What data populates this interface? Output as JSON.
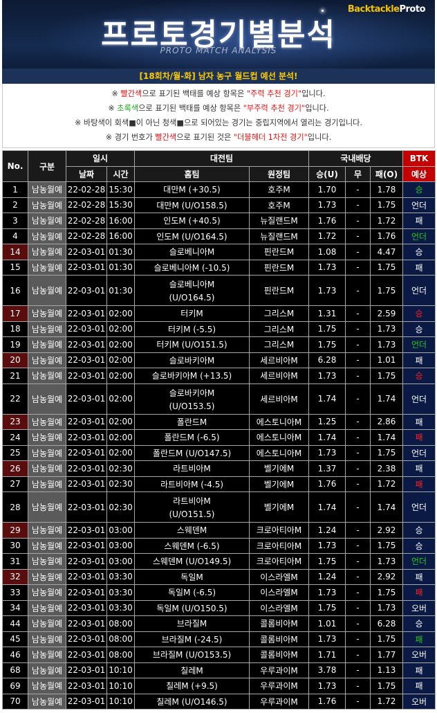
{
  "banner": {
    "brand_main": "Backtackle",
    "brand_sub": "Proto",
    "title": "프로토경기별분석",
    "subtitle": "PROTO MATCH ANALYSIS"
  },
  "round_title": "[18회차/월-화] 남자 농구 월드컵 예선 분석!",
  "notes": {
    "n1": {
      "pre": "※ ",
      "c1": "빨간색",
      "mid": "으로 표기된 백태를 예상 항목은 ",
      "c2": "\"주력 추천 경기\"",
      "post": "입니다."
    },
    "n2": {
      "pre": "※ ",
      "c1": "초록색",
      "mid": "으로 표기된 백태를 예상 항목은 ",
      "c2": "\"부주력 추천 경기\"",
      "post": "입니다."
    },
    "n3": "※ 바탕색이 회색■이 아닌 청색■으로 되어있는 경기는 중립지역에서 열리는 경기입니다.",
    "n4": {
      "pre": "※ 경기 번호가 ",
      "c1": "빨간색",
      "mid": "으로 표기된 것은 ",
      "c2": "\"더블헤더 1차전 경기\"",
      "post": "입니다."
    }
  },
  "table": {
    "headers": {
      "no": "No.",
      "gubun": "구분",
      "ilsi": "일시",
      "date": "날짜",
      "time": "시간",
      "match": "대전팀",
      "home": "홈팀",
      "away": "원정팀",
      "odds": "국내배당",
      "win": "승(U)",
      "draw": "무",
      "lose": "패(O)",
      "btk": "BTK",
      "pred": "예상"
    },
    "colors": {
      "main_pick": "#ff2222",
      "sub_pick": "#1ec81e",
      "normal": "#ffffff",
      "doubleheader_no": "#5a0d0d"
    },
    "rows": [
      {
        "no": "1",
        "gubun": "남농월예",
        "date": "22-02-28",
        "time": "15:30",
        "home": "대만M (+30.5)",
        "away": "호주M",
        "w": "1.70",
        "d": "-",
        "l": "1.78",
        "pred": "승",
        "pc": "green",
        "dh": false,
        "tall": false
      },
      {
        "no": "2",
        "gubun": "남농월예",
        "date": "22-02-28",
        "time": "15:30",
        "home": "대만M (U/O158.5)",
        "away": "호주M",
        "w": "1.73",
        "d": "-",
        "l": "1.75",
        "pred": "언더",
        "pc": "white",
        "dh": false,
        "tall": false
      },
      {
        "no": "3",
        "gubun": "남농월예",
        "date": "22-02-28",
        "time": "16:00",
        "home": "인도M (+40.5)",
        "away": "뉴질랜드M",
        "w": "1.76",
        "d": "-",
        "l": "1.72",
        "pred": "패",
        "pc": "white",
        "dh": false,
        "tall": false
      },
      {
        "no": "4",
        "gubun": "남농월예",
        "date": "22-02-28",
        "time": "16:00",
        "home": "인도M (U/O164.5)",
        "away": "뉴질랜드M",
        "w": "1.72",
        "d": "-",
        "l": "1.76",
        "pred": "언더",
        "pc": "green",
        "dh": false,
        "tall": false
      },
      {
        "no": "14",
        "gubun": "남농월예",
        "date": "22-03-01",
        "time": "01:30",
        "home": "슬로베니아M",
        "away": "핀란드M",
        "w": "1.08",
        "d": "-",
        "l": "4.47",
        "pred": "승",
        "pc": "white",
        "dh": true,
        "tall": false
      },
      {
        "no": "15",
        "gubun": "남농월예",
        "date": "22-03-01",
        "time": "01:30",
        "home": "슬로베니아M (-10.5)",
        "away": "핀란드M",
        "w": "1.73",
        "d": "-",
        "l": "1.75",
        "pred": "패",
        "pc": "white",
        "dh": false,
        "tall": false
      },
      {
        "no": "16",
        "gubun": "남농월예",
        "date": "22-03-01",
        "time": "01:30",
        "home": "슬로베니아M",
        "home2": "(U/O164.5)",
        "away": "핀란드M",
        "w": "1.73",
        "d": "-",
        "l": "1.75",
        "pred": "언더",
        "pc": "white",
        "dh": false,
        "tall": true
      },
      {
        "no": "17",
        "gubun": "남농월예",
        "date": "22-03-01",
        "time": "02:00",
        "home": "터키M",
        "away": "그리스M",
        "w": "1.31",
        "d": "-",
        "l": "2.59",
        "pred": "승",
        "pc": "red",
        "dh": true,
        "tall": false
      },
      {
        "no": "18",
        "gubun": "남농월예",
        "date": "22-03-01",
        "time": "02:00",
        "home": "터키M (-5.5)",
        "away": "그리스M",
        "w": "1.75",
        "d": "-",
        "l": "1.73",
        "pred": "승",
        "pc": "white",
        "dh": false,
        "tall": false
      },
      {
        "no": "19",
        "gubun": "남농월예",
        "date": "22-03-01",
        "time": "02:00",
        "home": "터키M (U/O151.5)",
        "away": "그리스M",
        "w": "1.75",
        "d": "-",
        "l": "1.73",
        "pred": "언더",
        "pc": "green",
        "dh": false,
        "tall": false
      },
      {
        "no": "20",
        "gubun": "남농월예",
        "date": "22-03-01",
        "time": "02:00",
        "home": "슬로바키아M",
        "away": "세르비아M",
        "w": "6.28",
        "d": "-",
        "l": "1.01",
        "pred": "패",
        "pc": "white",
        "dh": true,
        "tall": false
      },
      {
        "no": "21",
        "gubun": "남농월예",
        "date": "22-03-01",
        "time": "02:00",
        "home": "슬로바키아M (+13.5)",
        "away": "세르비아M",
        "w": "1.73",
        "d": "-",
        "l": "1.75",
        "pred": "승",
        "pc": "red",
        "dh": false,
        "tall": false
      },
      {
        "no": "22",
        "gubun": "남농월예",
        "date": "22-03-01",
        "time": "02:00",
        "home": "슬로바키아M",
        "home2": "(U/O153.5)",
        "away": "세르비아M",
        "w": "1.74",
        "d": "-",
        "l": "1.74",
        "pred": "언더",
        "pc": "white",
        "dh": false,
        "tall": true
      },
      {
        "no": "23",
        "gubun": "남농월예",
        "date": "22-03-01",
        "time": "02:00",
        "home": "폴란드M",
        "away": "에스토니아M",
        "w": "1.25",
        "d": "-",
        "l": "2.86",
        "pred": "패",
        "pc": "white",
        "dh": true,
        "tall": false
      },
      {
        "no": "24",
        "gubun": "남농월예",
        "date": "22-03-01",
        "time": "02:00",
        "home": "폴란드M (-6.5)",
        "away": "에스토니아M",
        "w": "1.74",
        "d": "-",
        "l": "1.74",
        "pred": "패",
        "pc": "red",
        "dh": false,
        "tall": false
      },
      {
        "no": "25",
        "gubun": "남농월예",
        "date": "22-03-01",
        "time": "02:00",
        "home": "폴란드M (U/O147.5)",
        "away": "에스토니아M",
        "w": "1.73",
        "d": "-",
        "l": "1.75",
        "pred": "언더",
        "pc": "white",
        "dh": false,
        "tall": false
      },
      {
        "no": "26",
        "gubun": "남농월예",
        "date": "22-03-01",
        "time": "02:30",
        "home": "라트비아M",
        "away": "벨기에M",
        "w": "1.37",
        "d": "-",
        "l": "2.38",
        "pred": "패",
        "pc": "white",
        "dh": true,
        "tall": false
      },
      {
        "no": "27",
        "gubun": "남농월예",
        "date": "22-03-01",
        "time": "02:30",
        "home": "라트비아M (-4.5)",
        "away": "벨기에M",
        "w": "1.76",
        "d": "-",
        "l": "1.72",
        "pred": "패",
        "pc": "red",
        "dh": false,
        "tall": false
      },
      {
        "no": "28",
        "gubun": "남농월예",
        "date": "22-03-01",
        "time": "02:30",
        "home": "라트비아M",
        "home2": "(U/O151.5)",
        "away": "벨기에M",
        "w": "1.74",
        "d": "-",
        "l": "1.74",
        "pred": "언더",
        "pc": "white",
        "dh": false,
        "tall": true
      },
      {
        "no": "29",
        "gubun": "남농월예",
        "date": "22-03-01",
        "time": "03:00",
        "home": "스웨덴M",
        "away": "크로아티아M",
        "w": "1.24",
        "d": "-",
        "l": "2.92",
        "pred": "승",
        "pc": "white",
        "dh": true,
        "tall": false
      },
      {
        "no": "30",
        "gubun": "남농월예",
        "date": "22-03-01",
        "time": "03:00",
        "home": "스웨덴M (-6.5)",
        "away": "크로아티아M",
        "w": "1.73",
        "d": "-",
        "l": "1.75",
        "pred": "승",
        "pc": "white",
        "dh": false,
        "tall": false
      },
      {
        "no": "31",
        "gubun": "남농월예",
        "date": "22-03-01",
        "time": "03:00",
        "home": "스웨덴M (U/O149.5)",
        "away": "크로아티아M",
        "w": "1.75",
        "d": "-",
        "l": "1.73",
        "pred": "언더",
        "pc": "green",
        "dh": false,
        "tall": false
      },
      {
        "no": "32",
        "gubun": "남농월예",
        "date": "22-03-01",
        "time": "03:30",
        "home": "독일M",
        "away": "이스라엘M",
        "w": "1.24",
        "d": "-",
        "l": "2.92",
        "pred": "패",
        "pc": "white",
        "dh": true,
        "tall": false
      },
      {
        "no": "33",
        "gubun": "남농월예",
        "date": "22-03-01",
        "time": "03:30",
        "home": "독일M (-6.5)",
        "away": "이스라엘M",
        "w": "1.73",
        "d": "-",
        "l": "1.75",
        "pred": "패",
        "pc": "red",
        "dh": false,
        "tall": false
      },
      {
        "no": "34",
        "gubun": "남농월예",
        "date": "22-03-01",
        "time": "03:30",
        "home": "독일M (U/O150.5)",
        "away": "이스라엘M",
        "w": "1.75",
        "d": "-",
        "l": "1.73",
        "pred": "오버",
        "pc": "white",
        "dh": false,
        "tall": false
      },
      {
        "no": "44",
        "gubun": "남농월예",
        "date": "22-03-01",
        "time": "08:00",
        "home": "브라질M",
        "away": "콜롬비아M",
        "w": "1.01",
        "d": "-",
        "l": "6.28",
        "pred": "승",
        "pc": "white",
        "dh": false,
        "tall": false
      },
      {
        "no": "45",
        "gubun": "남농월예",
        "date": "22-03-01",
        "time": "08:00",
        "home": "브라질M (-24.5)",
        "away": "콜롬비아M",
        "w": "1.73",
        "d": "-",
        "l": "1.75",
        "pred": "패",
        "pc": "green",
        "dh": false,
        "tall": false
      },
      {
        "no": "46",
        "gubun": "남농월예",
        "date": "22-03-01",
        "time": "08:00",
        "home": "브라질M (U/O153.5)",
        "away": "콜롬비아M",
        "w": "1.71",
        "d": "-",
        "l": "1.77",
        "pred": "오버",
        "pc": "white",
        "dh": false,
        "tall": false
      },
      {
        "no": "68",
        "gubun": "남농월예",
        "date": "22-03-01",
        "time": "10:10",
        "home": "칠레M",
        "away": "우루과이M",
        "w": "3.78",
        "d": "-",
        "l": "1.13",
        "pred": "패",
        "pc": "white",
        "dh": false,
        "tall": false
      },
      {
        "no": "69",
        "gubun": "남농월예",
        "date": "22-03-01",
        "time": "10:10",
        "home": "칠레M (+9.5)",
        "away": "우루과이M",
        "w": "1.73",
        "d": "-",
        "l": "1.75",
        "pred": "패",
        "pc": "white",
        "dh": false,
        "tall": false
      },
      {
        "no": "70",
        "gubun": "남농월예",
        "date": "22-03-01",
        "time": "10:10",
        "home": "칠레M (U/O146.5)",
        "away": "우루과이M",
        "w": "1.76",
        "d": "-",
        "l": "1.72",
        "pred": "오버",
        "pc": "white",
        "dh": false,
        "tall": false
      }
    ]
  }
}
